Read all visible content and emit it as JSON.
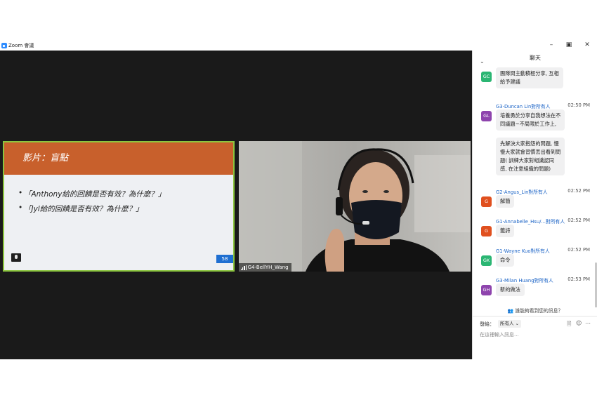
{
  "window": {
    "title": "Zoom 會議",
    "icons": [
      "zoom-logo",
      "minimize-icon",
      "restore-icon",
      "close-icon"
    ]
  },
  "slide": {
    "header": "影片：盲點",
    "bullets": [
      "「Anthony給的回饋是否有效？為什麼？」",
      "「Jyl給的回饋是否有效？為什麼？」"
    ],
    "page_number": "58"
  },
  "video": {
    "participant_name": "G4-BellYH_Wang"
  },
  "chat": {
    "title": "聊天",
    "messages": [
      {
        "initials": "GC",
        "avatar_color": "#2bb673",
        "sender": "",
        "time": "",
        "lines": [
          "團隊間主動積極分享, 互相",
          "給予建議"
        ]
      },
      {
        "initials": "GL",
        "avatar_color": "#8e44ad",
        "sender": "G3-Duncan Lin對所有人",
        "time": "02:50 PM",
        "lines": [
          "培養勇於分享自我想法在不",
          "同議題~不局限於工作上,"
        ]
      },
      {
        "initials": "",
        "avatar_color": "",
        "sender": "",
        "time": "",
        "lines": [
          "先解決大家抱怨的問題, 慢",
          "慢大家就會習慣丟出看到問",
          "題( 訓練大家對組識認同",
          "感, 在注意組織的問題)"
        ]
      },
      {
        "initials": "G",
        "avatar_color": "#e0501f",
        "sender": "G2-Angus_Lin對所有人",
        "time": "02:52 PM",
        "lines": [
          "解簡"
        ]
      },
      {
        "initials": "G",
        "avatar_color": "#e0501f",
        "sender": "G1-Annabelle_Hsu/...對所有人",
        "time": "02:52 PM",
        "lines": [
          "籤詩"
        ]
      },
      {
        "initials": "GK",
        "avatar_color": "#2bb673",
        "sender": "G1-Wayne Kuo對所有人",
        "time": "02:52 PM",
        "lines": [
          "命令"
        ]
      },
      {
        "initials": "GH",
        "avatar_color": "#8e44ad",
        "sender": "G3-Milan Huang對所有人",
        "time": "02:53 PM",
        "lines": [
          "新的做法"
        ]
      }
    ],
    "who_can_see": "誰能夠看到您的訊息？",
    "send_label": "發給：",
    "send_target": "所有人",
    "input_placeholder": "在這裡輸入訊息..."
  }
}
